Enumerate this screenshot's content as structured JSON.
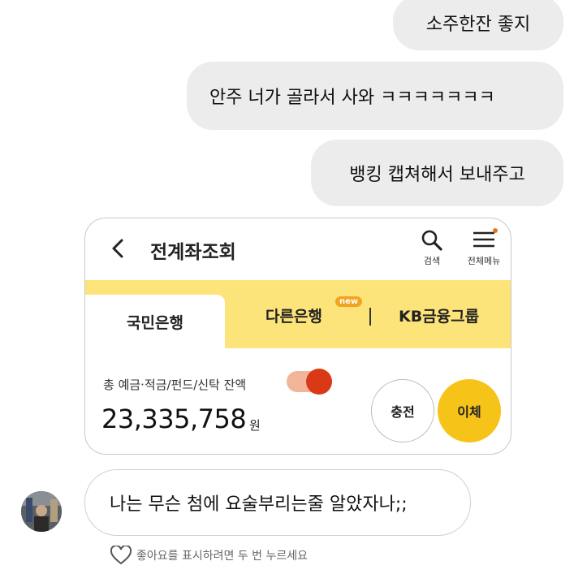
{
  "messages": {
    "right": [
      {
        "text": "소주한잔 좋지"
      },
      {
        "text": "안주 너가 골라서 사와 ㅋㅋㅋㅋㅋㅋㅋ"
      },
      {
        "text": "뱅킹 캡쳐해서 보내주고"
      }
    ],
    "left": {
      "text": "나는 무슨 첨에 요술부리는줄 알았자나;;"
    }
  },
  "bank_card": {
    "title": "전계좌조회",
    "search_label": "검색",
    "menu_label": "전체메뉴",
    "tabs": [
      {
        "label": "국민은행",
        "active": true
      },
      {
        "label": "다른은행",
        "badge": "new"
      },
      {
        "label": "KB금융그룹"
      }
    ],
    "balance_label": "총 예금·적금/펀드/신탁 잔액",
    "balance_amount": "23,335,758",
    "currency": "원",
    "charge_button": "충전",
    "transfer_button": "이체",
    "colors": {
      "tab_bar": "#fde47a",
      "transfer": "#f6c318",
      "toggle_knob": "#d93a15",
      "badge": "#f2a31f"
    }
  },
  "like_hint": "좋아요를 표시하려면 두 번 누르세요"
}
